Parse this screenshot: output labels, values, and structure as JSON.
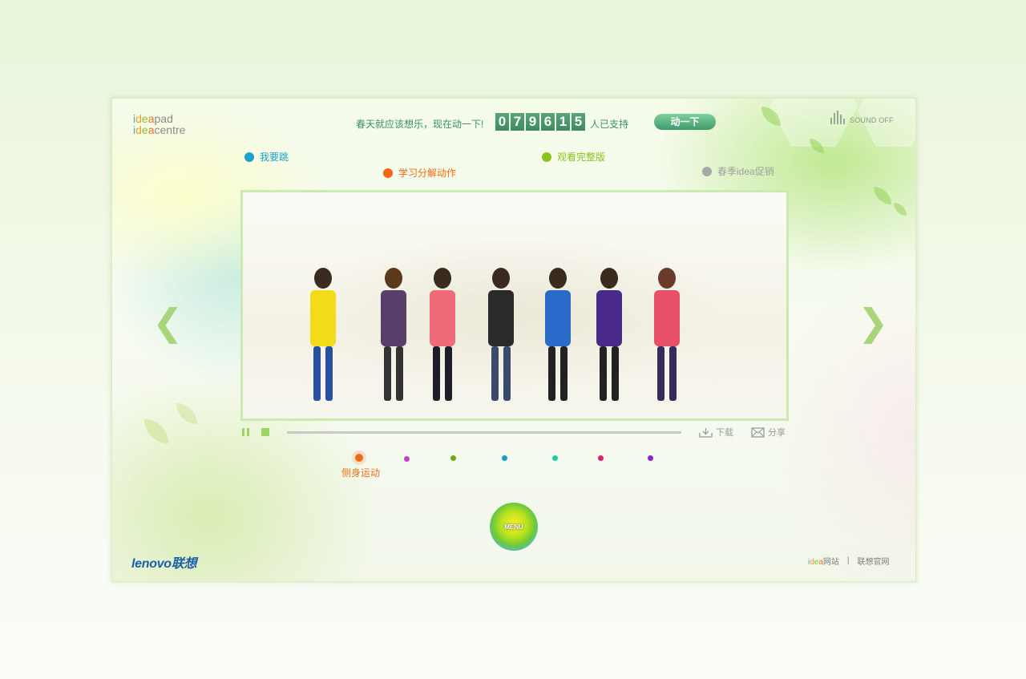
{
  "header": {
    "logo_row1": [
      "i",
      "d",
      "e",
      "a",
      "pad"
    ],
    "logo_row2": [
      "i",
      "d",
      "e",
      "a",
      "centre"
    ],
    "slogan": "春天就应该想乐，现在动一下!",
    "counter_digits": [
      "0",
      "7",
      "9",
      "6",
      "1",
      "5"
    ],
    "support_text": "人已支持",
    "move_button": "动一下",
    "sound_label": "SOUND OFF"
  },
  "nav": {
    "dance": "我要跳",
    "learn": "学习分解动作",
    "full_version": "观看完整版",
    "promo": "春季idea促销"
  },
  "colors": {
    "dance": "#1aa1cc",
    "learn": "#f26a10",
    "full_version": "#8cc21e",
    "promo": "#a8a8a8"
  },
  "arrows": {
    "prev": "❮",
    "next": "❯"
  },
  "tools": {
    "download": "下载",
    "share": "分享"
  },
  "moves": {
    "active_label": "侧身运动",
    "colors": [
      "#f06a1a",
      "#c040c8",
      "#6aa81a",
      "#1aa0c8",
      "#1ad0a0",
      "#e0206a",
      "#8a20e0"
    ]
  },
  "menu_label": "MENU",
  "footer": {
    "brand": "lenovo联想",
    "idea_prefix": [
      "i",
      "d",
      "e",
      "a"
    ],
    "idea_site": "网站",
    "separator": "|",
    "official": "联想官网"
  }
}
